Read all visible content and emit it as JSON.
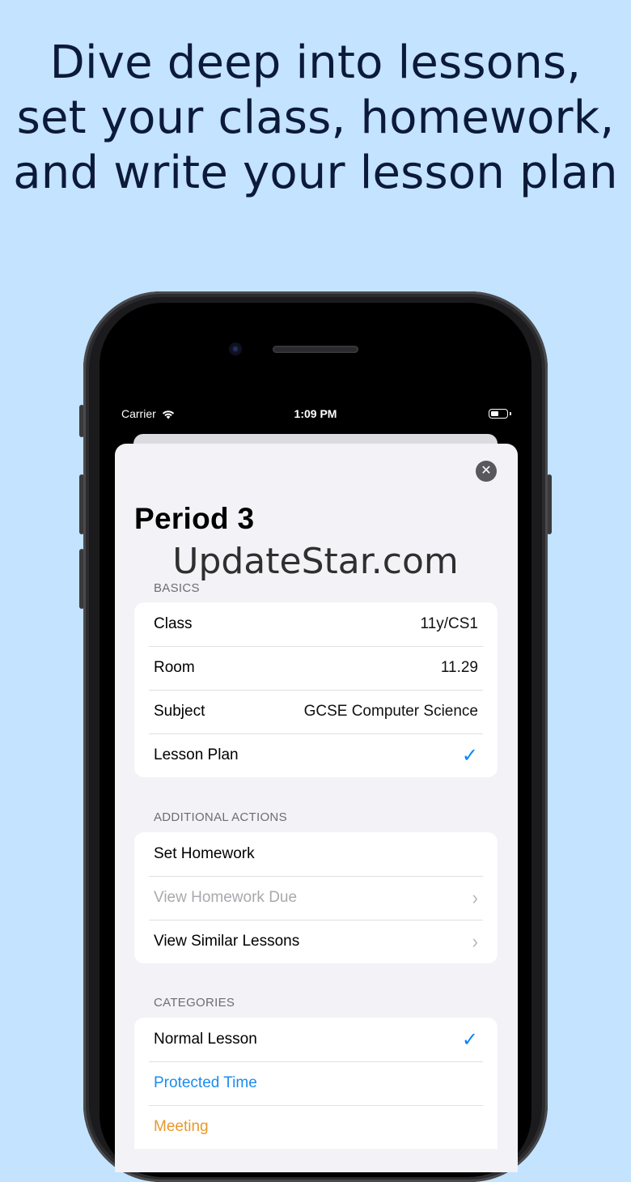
{
  "headline": {
    "line1": "Dive deep into lessons,",
    "line2": "set your class, homework,",
    "line3": "and write your lesson plan"
  },
  "status_bar": {
    "carrier": "Carrier",
    "time": "1:09 PM"
  },
  "sheet": {
    "title": "Period 3",
    "close_icon": "close-icon",
    "watermark": "UpdateStar.com"
  },
  "basics": {
    "header": "BASICS",
    "rows": [
      {
        "label": "Class",
        "value": "11y/CS1"
      },
      {
        "label": "Room",
        "value": "11.29"
      },
      {
        "label": "Subject",
        "value": "GCSE Computer Science"
      },
      {
        "label": "Lesson Plan",
        "value": "✓"
      }
    ]
  },
  "additional_actions": {
    "header": "ADDITIONAL ACTIONS",
    "rows": [
      {
        "label": "Set Homework"
      },
      {
        "label": "View Homework Due",
        "disabled": true
      },
      {
        "label": "View Similar Lessons"
      }
    ]
  },
  "categories": {
    "header": "CATEGORIES",
    "rows": [
      {
        "label": "Normal Lesson",
        "selected": true
      },
      {
        "label": "Protected Time",
        "color": "#1a8cf0"
      },
      {
        "label": "Meeting",
        "color": "#e89a2b"
      }
    ]
  },
  "colors": {
    "background": "#c3e3fe",
    "accent": "#0a84ff"
  }
}
